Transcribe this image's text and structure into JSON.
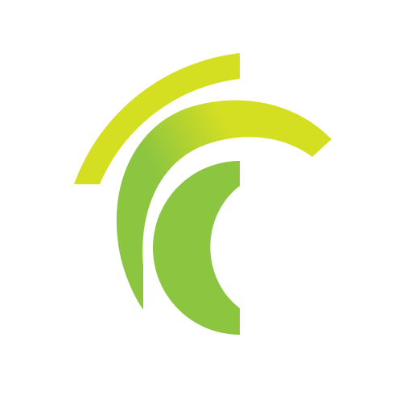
{
  "logo": {
    "name": "concentric-arcs-logo",
    "colors": {
      "background": "#ffffff",
      "outer_arc": "#d5df22",
      "middle_arc_start": "#d5df22",
      "middle_arc_end": "#8cc540",
      "inner_arc": "#8cc540"
    }
  }
}
